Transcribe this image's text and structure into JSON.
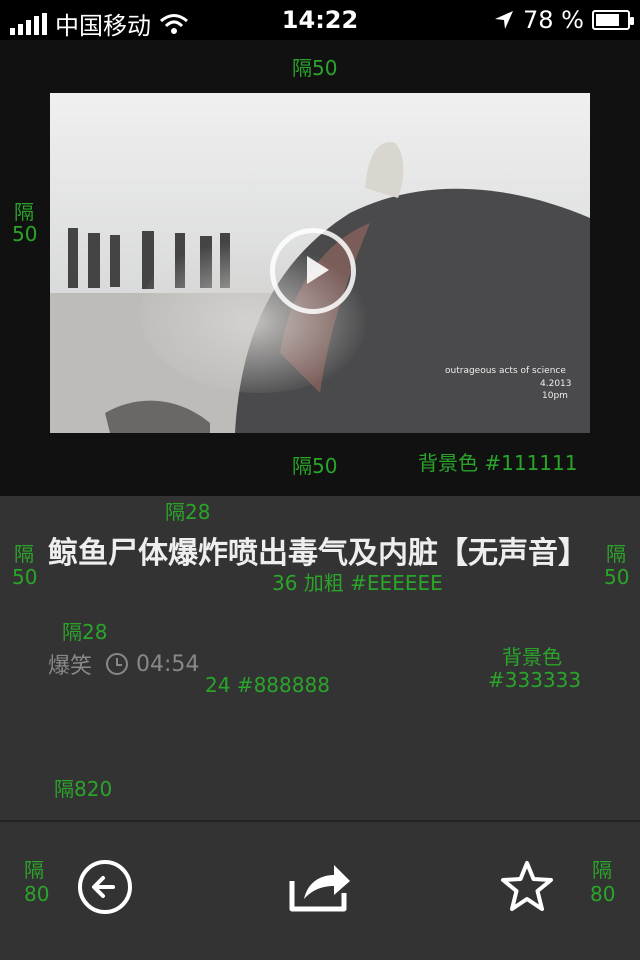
{
  "status_bar": {
    "carrier": "中国移动",
    "time": "14:22",
    "battery_percent": "78 %",
    "battery_level": 0.78
  },
  "video": {
    "watermark_line1": "outrageous acts of science",
    "watermark_line2": "4.2013",
    "watermark_line3": "10pm"
  },
  "article": {
    "title": "鲸鱼尸体爆炸喷出毒气及内脏【无声音】",
    "category": "爆笑",
    "duration": "04:54"
  },
  "toolbar": {
    "icons": [
      "back-icon",
      "share-icon",
      "star-icon"
    ]
  },
  "annotations": {
    "gap50_top": "隔50",
    "gap50_left_1": "隔",
    "gap50_left_2": "50",
    "gap50_bottom": "隔50",
    "bg_111": "背景色 #111111",
    "gap28_top": "隔28",
    "gap50_info_left_1": "隔",
    "gap50_info_left_2": "50",
    "gap50_info_right_1": "隔",
    "gap50_info_right_2": "50",
    "title_style": "36 加粗 #EEEEEE",
    "gap28_mid": "隔28",
    "meta_style": "24 #888888",
    "bg_333_1": "背景色",
    "bg_333_2": "#333333",
    "gap820": "隔820",
    "gap80_left_1": "隔",
    "gap80_left_2": "80",
    "gap80_right_1": "隔",
    "gap80_right_2": "80"
  },
  "colors": {
    "video_bg": "#111111",
    "info_bg": "#333333",
    "title": "#EEEEEE",
    "meta": "#888888",
    "annotation": "#2aa52a"
  }
}
